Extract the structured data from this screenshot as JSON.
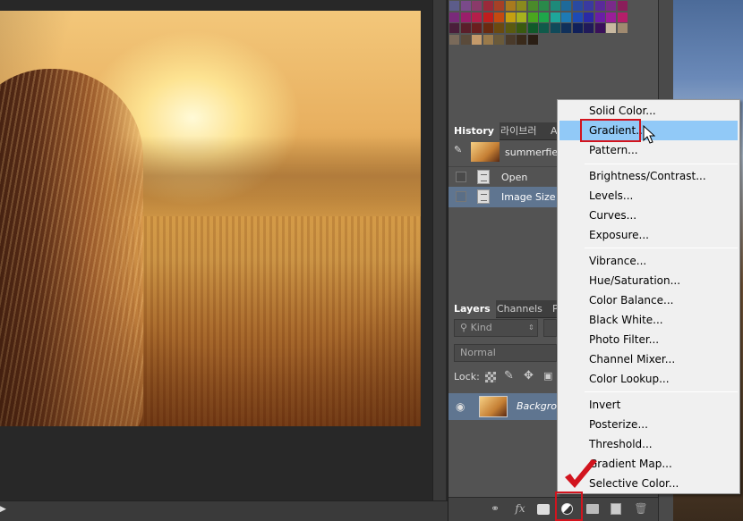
{
  "history_panel": {
    "tabs": [
      "History",
      "라이브러",
      "A"
    ],
    "snapshot_name": "summerfiel",
    "items": [
      "Open",
      "Image Size"
    ]
  },
  "layers_panel": {
    "tabs": [
      "Layers",
      "Channels",
      "P"
    ],
    "filter_value": "Kind",
    "blend_mode": "Normal",
    "lock_label": "Lock:",
    "layer_name": "Backgrou"
  },
  "adjustment_menu": {
    "groups": [
      [
        "Solid Color...",
        "Gradient...",
        "Pattern..."
      ],
      [
        "Brightness/Contrast...",
        "Levels...",
        "Curves...",
        "Exposure..."
      ],
      [
        "Vibrance...",
        "Hue/Saturation...",
        "Color Balance...",
        "Black  White...",
        "Photo Filter...",
        "Channel Mixer...",
        "Color Lookup..."
      ],
      [
        "Invert",
        "Posterize...",
        "Threshold...",
        "Gradient Map...",
        "Selective Color..."
      ]
    ],
    "highlighted": "Gradient..."
  },
  "layer_toolbar": {
    "icons": [
      "link-icon",
      "fx-icon",
      "mask-icon",
      "adjustment-layer-icon",
      "folder-icon",
      "new-layer-icon",
      "trash-icon"
    ],
    "fx_label": "fx"
  },
  "colors": {
    "panel_bg": "#535353",
    "menu_highlight": "#91c9f7",
    "annotation_red": "#d2141e"
  }
}
